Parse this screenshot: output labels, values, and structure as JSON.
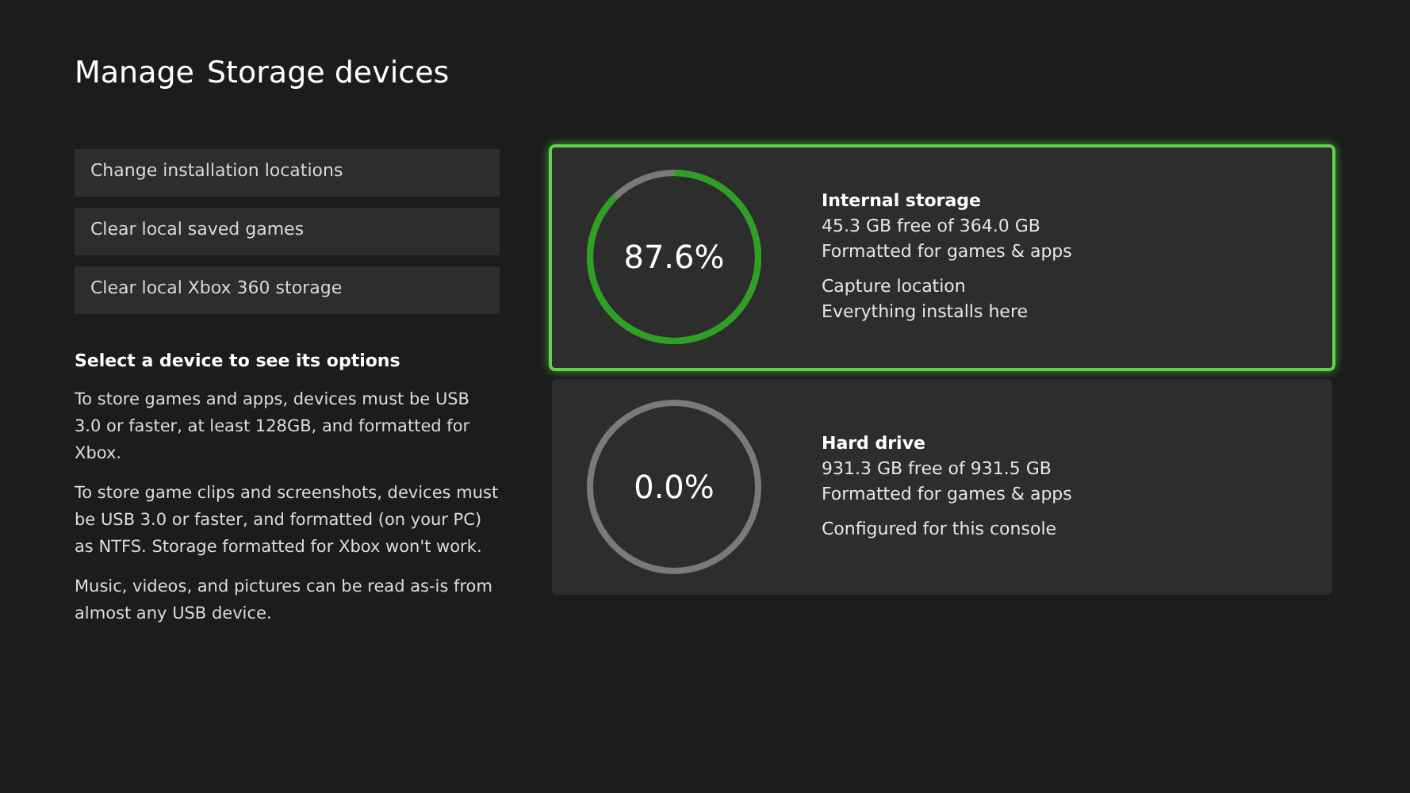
{
  "header": {
    "section": "Manage",
    "title": "Storage devices"
  },
  "actions": [
    "Change installation locations",
    "Clear local saved games",
    "Clear local Xbox 360 storage"
  ],
  "info": {
    "heading": "Select a device to see its options",
    "paragraphs": [
      "To store games and apps, devices must be USB 3.0 or faster, at least 128GB, and formatted for Xbox.",
      "To store game clips and screenshots, devices must be USB 3.0 or faster, and formatted (on your PC) as NTFS. Storage formatted for Xbox won't work.",
      "Music, videos, and pictures can be read as-is from almost any USB device."
    ]
  },
  "devices": [
    {
      "name": "Internal storage",
      "usage": "87.6%",
      "level": 0.876,
      "selected": true,
      "details": [
        [
          "45.3 GB free of 364.0 GB",
          "Formatted for games & apps"
        ],
        [
          "Capture location",
          "Everything installs here"
        ]
      ]
    },
    {
      "name": "Hard drive",
      "usage": "0.0%",
      "level": 0,
      "selected": false,
      "details": [
        [
          "931.3 GB free of 931.5 GB",
          "Formatted for games & apps"
        ],
        [
          "Configured for this console"
        ]
      ]
    }
  ]
}
